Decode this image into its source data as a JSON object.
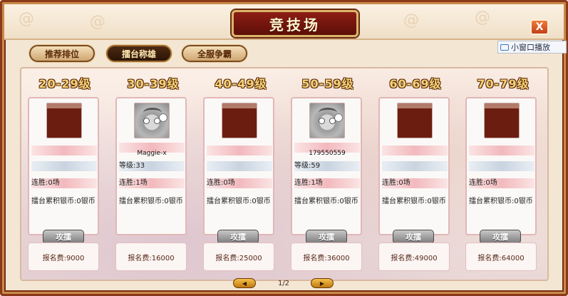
{
  "title": "竞技场",
  "close_label": "X",
  "mini_play_label": "小窗口播放",
  "tabs": [
    {
      "label": "推荐排位",
      "active": false
    },
    {
      "label": "擂台称雄",
      "active": true
    },
    {
      "label": "全服争霸",
      "active": false
    }
  ],
  "levels": [
    {
      "title": "20-29级",
      "name": "",
      "level": "",
      "streak": "连胜:0场",
      "accumulated": "擂台累积银币:0银币",
      "attack": "攻擂",
      "fee": "报名费:9000",
      "has_portrait": false
    },
    {
      "title": "30-39级",
      "name": "Maggie-x",
      "level": "等级:33",
      "streak": "连胜:1场",
      "accumulated": "擂台累积银币:0银币",
      "attack": "",
      "fee": "报名费:16000",
      "has_portrait": true
    },
    {
      "title": "40-49级",
      "name": "",
      "level": "",
      "streak": "连胜:0场",
      "accumulated": "擂台累积银币:0银币",
      "attack": "攻擂",
      "fee": "报名费:25000",
      "has_portrait": false
    },
    {
      "title": "50-59级",
      "name": "179550559",
      "level": "等级:59",
      "streak": "连胜:1场",
      "accumulated": "擂台累积银币:0银币",
      "attack": "攻擂",
      "fee": "报名费:36000",
      "has_portrait": true
    },
    {
      "title": "60-69级",
      "name": "",
      "level": "",
      "streak": "连胜:0场",
      "accumulated": "擂台累积银币:0银币",
      "attack": "攻擂",
      "fee": "报名费:49000",
      "has_portrait": false
    },
    {
      "title": "70-79级",
      "name": "",
      "level": "",
      "streak": "连胜:0场",
      "accumulated": "擂台累积银币:0银币",
      "attack": "攻擂",
      "fee": "报名费:64000",
      "has_portrait": false
    }
  ],
  "pager": {
    "text": "1/2",
    "prev_icon": "◀",
    "next_icon": "▶"
  },
  "colors": {
    "accent": "#8d1e14",
    "gold": "#f6d47a"
  }
}
